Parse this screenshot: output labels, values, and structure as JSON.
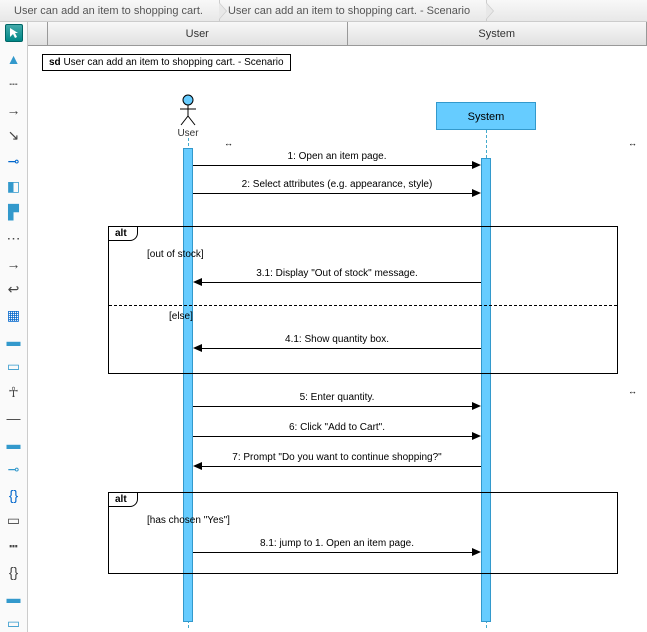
{
  "breadcrumb": {
    "item1": "User can add an item to shopping cart.",
    "item2": "User can add an item to shopping cart. - Scenario"
  },
  "headers": {
    "user": "User",
    "system": "System"
  },
  "frame": {
    "prefix": "sd",
    "title": "User can add an item to shopping cart. - Scenario"
  },
  "actors": {
    "user": "User",
    "system": "System"
  },
  "messages": {
    "m1": "1: Open an item page.",
    "m2": "2: Select attributes (e.g. appearance, style)",
    "m3_1": "3.1: Display \"Out of stock\" message.",
    "m4_1": "4.1: Show quantity box.",
    "m5": "5: Enter quantity.",
    "m6": "6: Click \"Add to Cart\".",
    "m7": "7: Prompt \"Do you want to continue shopping?\"",
    "m8_1": "8.1: jump to 1. Open an item page."
  },
  "fragments": {
    "alt1": "alt",
    "guard1": "[out of stock]",
    "guard2": "[else]",
    "alt2": "alt",
    "guard3": "[has chosen \"Yes\"]"
  }
}
